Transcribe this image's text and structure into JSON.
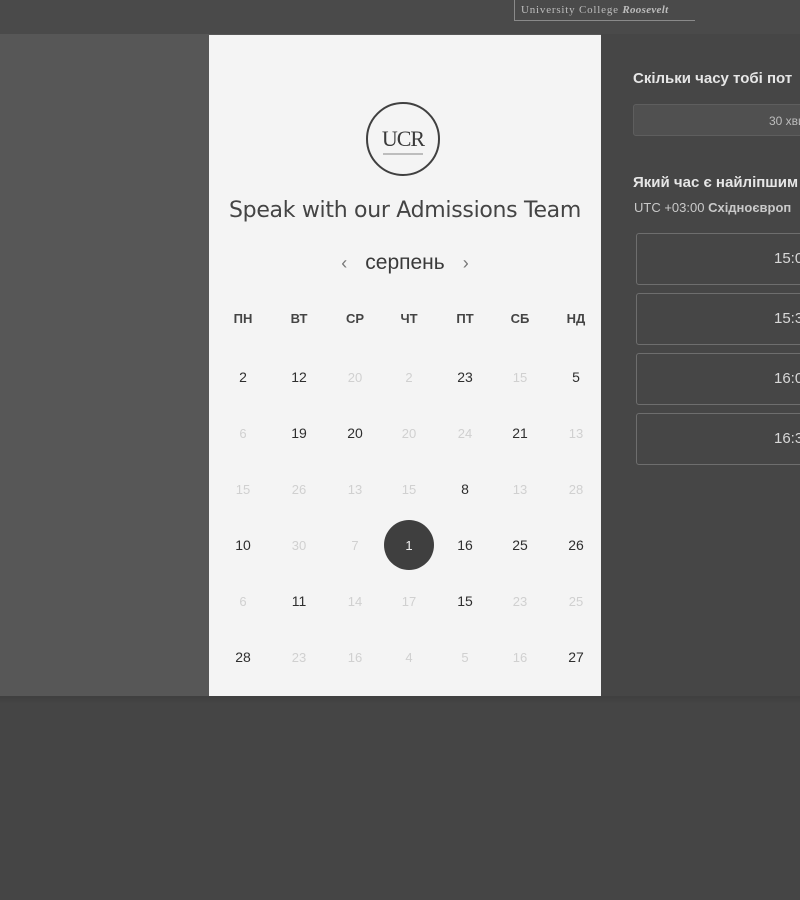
{
  "header": {
    "brand_text": "University College",
    "brand_text_bold": "Roosevelt"
  },
  "card": {
    "logo_text": "UCR",
    "title": "Speak with our Admissions Team",
    "month": "серпень",
    "prev_icon": "chevron-left-icon",
    "next_icon": "chevron-right-icon",
    "weekdays": [
      "ПН",
      "ВТ",
      "СР",
      "ЧТ",
      "ПТ",
      "СБ",
      "НД"
    ],
    "weeks": [
      [
        {
          "d": "2",
          "s": "active"
        },
        {
          "d": "12",
          "s": "active"
        },
        {
          "d": "20",
          "s": "disabled"
        },
        {
          "d": "2",
          "s": "disabled"
        },
        {
          "d": "23",
          "s": "active"
        },
        {
          "d": "15",
          "s": "disabled"
        },
        {
          "d": "5",
          "s": "active"
        }
      ],
      [
        {
          "d": "6",
          "s": "disabled"
        },
        {
          "d": "19",
          "s": "active"
        },
        {
          "d": "20",
          "s": "active"
        },
        {
          "d": "20",
          "s": "disabled"
        },
        {
          "d": "24",
          "s": "disabled"
        },
        {
          "d": "21",
          "s": "active"
        },
        {
          "d": "13",
          "s": "disabled"
        }
      ],
      [
        {
          "d": "15",
          "s": "disabled"
        },
        {
          "d": "26",
          "s": "disabled"
        },
        {
          "d": "13",
          "s": "disabled"
        },
        {
          "d": "15",
          "s": "disabled"
        },
        {
          "d": "8",
          "s": "active"
        },
        {
          "d": "13",
          "s": "disabled"
        },
        {
          "d": "28",
          "s": "disabled"
        }
      ],
      [
        {
          "d": "10",
          "s": "active"
        },
        {
          "d": "30",
          "s": "disabled"
        },
        {
          "d": "7",
          "s": "disabled"
        },
        {
          "d": "1",
          "s": "selected"
        },
        {
          "d": "16",
          "s": "active"
        },
        {
          "d": "25",
          "s": "active"
        },
        {
          "d": "26",
          "s": "active"
        }
      ],
      [
        {
          "d": "6",
          "s": "disabled"
        },
        {
          "d": "11",
          "s": "active"
        },
        {
          "d": "14",
          "s": "disabled"
        },
        {
          "d": "17",
          "s": "disabled"
        },
        {
          "d": "15",
          "s": "active"
        },
        {
          "d": "23",
          "s": "disabled"
        },
        {
          "d": "25",
          "s": "disabled"
        }
      ],
      [
        {
          "d": "28",
          "s": "active"
        },
        {
          "d": "23",
          "s": "disabled"
        },
        {
          "d": "16",
          "s": "disabled"
        },
        {
          "d": "4",
          "s": "disabled"
        },
        {
          "d": "5",
          "s": "disabled"
        },
        {
          "d": "16",
          "s": "disabled"
        },
        {
          "d": "27",
          "s": "active"
        }
      ]
    ]
  },
  "side": {
    "duration_question": "Скільки часу тобі пот",
    "duration_value": "30 хвил",
    "time_question": "Який час є найліпшим",
    "timezone_prefix": "UTC +03:00",
    "timezone_name": "Східноєвроп",
    "time_slots": [
      "15:0",
      "15:3",
      "16:0",
      "16:3"
    ]
  }
}
